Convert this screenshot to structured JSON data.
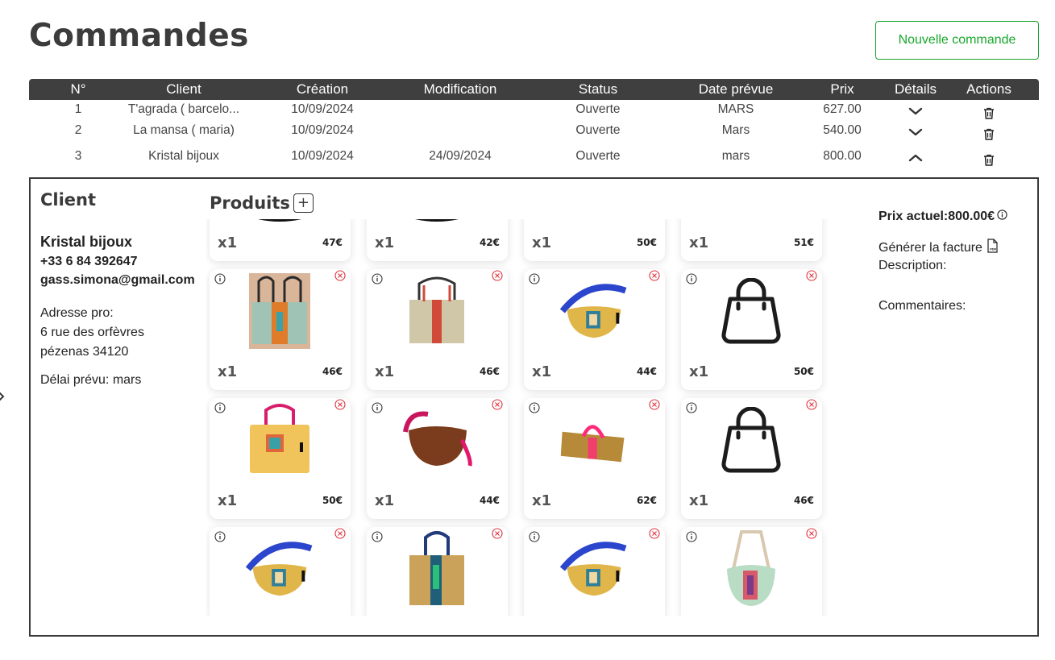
{
  "page": {
    "title": "Commandes",
    "new_order_label": "Nouvelle commande"
  },
  "table": {
    "headers": [
      "N°",
      "Client",
      "Création",
      "Modification",
      "Status",
      "Date prévue",
      "Prix",
      "Détails",
      "Actions"
    ],
    "rows": [
      {
        "num": "1",
        "client": "T'agrada ( barcelo...",
        "creation": "10/09/2024",
        "modification": "",
        "status": "Ouverte",
        "date": "MARS",
        "prix": "627.00",
        "expanded": false
      },
      {
        "num": "2",
        "client": "La mansa ( maria)",
        "creation": "10/09/2024",
        "modification": "",
        "status": "Ouverte",
        "date": "Mars",
        "prix": "540.00",
        "expanded": false
      },
      {
        "num": "3",
        "client": "Kristal bijoux",
        "creation": "10/09/2024",
        "modification": "24/09/2024",
        "status": "Ouverte",
        "date": "mars",
        "prix": "800.00",
        "expanded": true
      }
    ]
  },
  "client": {
    "heading": "Client",
    "name": "Kristal bijoux",
    "phone": "+33 6 84 392647",
    "email": "gass.simona@gmail.com",
    "address_label": "Adresse pro:",
    "address_line1": "6 rue des orfèvres",
    "address_line2": "pézenas 34120",
    "delay": "Délai prévu: mars"
  },
  "products": {
    "heading": "Produits",
    "add_symbol": "+",
    "items": [
      {
        "qty": "x1",
        "price": "47€",
        "img": "black-bag"
      },
      {
        "qty": "x1",
        "price": "42€",
        "img": "black-bag"
      },
      {
        "qty": "x1",
        "price": "50€",
        "img": "none"
      },
      {
        "qty": "x1",
        "price": "51€",
        "img": "none"
      },
      {
        "qty": "x1",
        "price": "46€",
        "img": "green-tote"
      },
      {
        "qty": "x1",
        "price": "46€",
        "img": "beige-tote"
      },
      {
        "qty": "x1",
        "price": "44€",
        "img": "yellow-crossbody"
      },
      {
        "qty": "x1",
        "price": "50€",
        "img": "placeholder-bag"
      },
      {
        "qty": "x1",
        "price": "50€",
        "img": "yellow-tote"
      },
      {
        "qty": "x1",
        "price": "44€",
        "img": "brown-crossbody"
      },
      {
        "qty": "x1",
        "price": "62€",
        "img": "gold-duffel"
      },
      {
        "qty": "x1",
        "price": "46€",
        "img": "placeholder-bag"
      },
      {
        "qty": "",
        "price": "",
        "img": "yellow-crossbody"
      },
      {
        "qty": "",
        "price": "",
        "img": "gold-tote"
      },
      {
        "qty": "",
        "price": "",
        "img": "yellow-crossbody"
      },
      {
        "qty": "",
        "price": "",
        "img": "mint-crossbody"
      }
    ]
  },
  "summary": {
    "price_label": "Prix actuel:800.00€",
    "invoice_label": "Générer la facture",
    "description_label": "Description:",
    "comments_label": "Commentaires:"
  },
  "colors": {
    "header_bg": "#3f3f3f",
    "accent_green": "#18a82c",
    "remove_red": "#e0323c"
  }
}
